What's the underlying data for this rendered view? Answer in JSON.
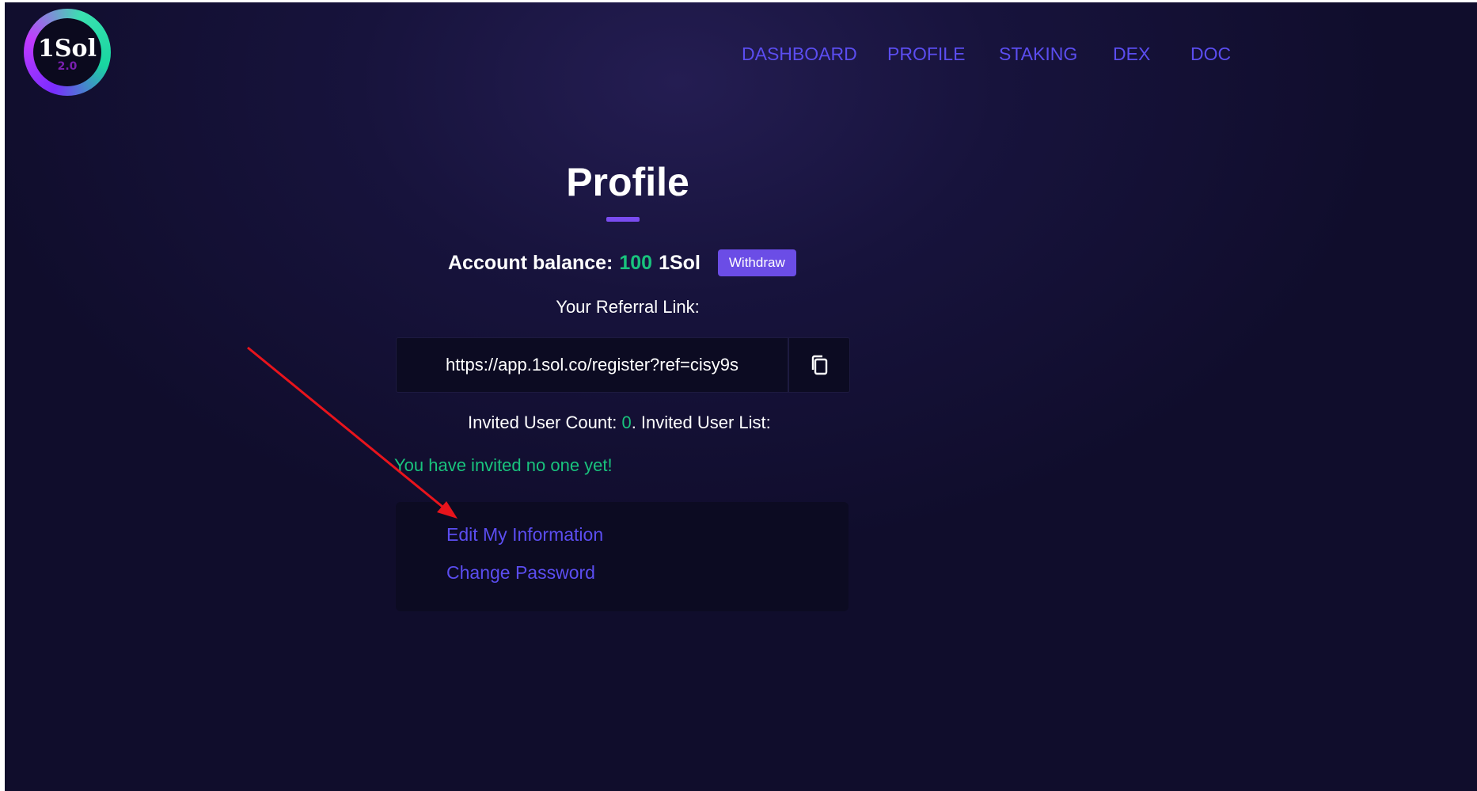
{
  "logo": {
    "text": "1Sol",
    "version": "2.0"
  },
  "nav": {
    "items": [
      {
        "label": "DASHBOARD"
      },
      {
        "label": "PROFILE"
      },
      {
        "label": "STAKING"
      },
      {
        "label": "DEX"
      },
      {
        "label": "DOC"
      }
    ]
  },
  "profile": {
    "title": "Profile",
    "balance_label": "Account balance:",
    "balance_value": "100",
    "balance_unit": "1Sol",
    "withdraw_label": "Withdraw",
    "referral_label": "Your Referral Link:",
    "referral_link": "https://app.1sol.co/register?ref=cisy9s",
    "invited_count_label": "Invited User Count:",
    "invited_count": "0",
    "invited_list_label": ". Invited User List:",
    "no_invite_text": "You have invited no one yet!",
    "links": {
      "edit_info": "Edit My Information",
      "change_password": "Change Password"
    }
  },
  "icons": {
    "copy": "copy-icon"
  },
  "colors": {
    "accent": "#5b4df0",
    "success": "#19c37d",
    "button": "#6b4de6",
    "annotation_arrow": "#e8141c"
  }
}
